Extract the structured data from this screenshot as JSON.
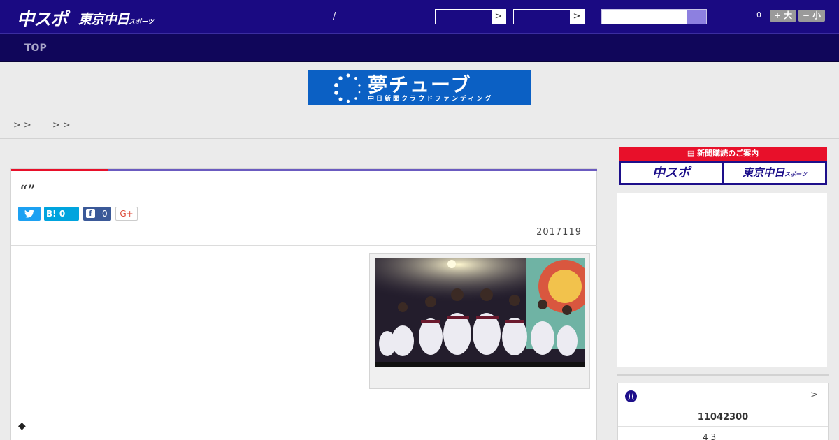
{
  "header": {
    "logo_chuspo": "中スポ",
    "logo_tokyo": "東京中日",
    "logo_tokyo_suffix": "スポーツ",
    "separator": "/",
    "select_arrow": ">",
    "count": "0",
    "font_large_label": "+ 大",
    "font_small_label": "− 小"
  },
  "nav": {
    "top_label": "TOP"
  },
  "banner": {
    "title": "夢チューブ",
    "subtitle": "中日新聞クラウドファンディング"
  },
  "breadcrumb": {
    "sep1": ">",
    "sep2": ">",
    "sep3": ">",
    "sep4": ">"
  },
  "article": {
    "title": "“”",
    "share": {
      "twitter_icon": "twitter-bird",
      "hatena_label": "B!",
      "hatena_count": "0",
      "facebook_label": "f",
      "facebook_count": "0",
      "gplus_label": "G+"
    },
    "date": "2017119",
    "bullet": "◆"
  },
  "sidebar": {
    "subscribe_heading": "新聞購読のご案内",
    "subscribe_chuspo": "中スポ",
    "subscribe_tokyo": "東京中日",
    "subscribe_tokyo_suffix": "スポーツ",
    "score_arrow": ">",
    "score_number": "11042300",
    "score_game": "4  3"
  },
  "colors": {
    "header_bg": "#1a0a82",
    "nav_bg": "#10065a",
    "accent_red": "#e8102a",
    "accent_purple": "#6b5bc0"
  }
}
